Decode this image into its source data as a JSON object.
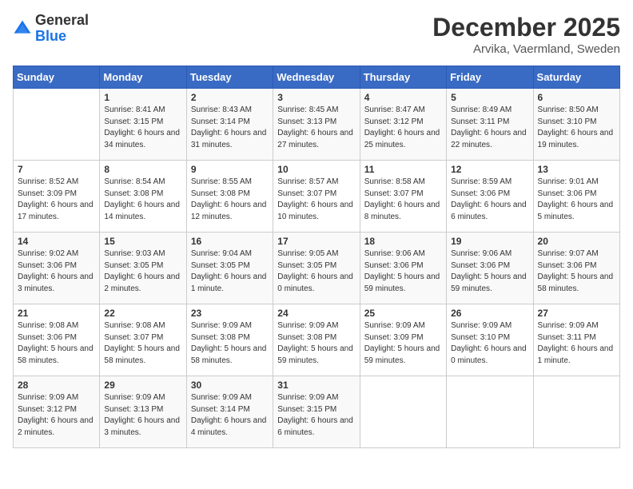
{
  "header": {
    "logo_line1": "General",
    "logo_line2": "Blue",
    "month": "December 2025",
    "location": "Arvika, Vaermland, Sweden"
  },
  "weekdays": [
    "Sunday",
    "Monday",
    "Tuesday",
    "Wednesday",
    "Thursday",
    "Friday",
    "Saturday"
  ],
  "weeks": [
    [
      {
        "day": "",
        "sunrise": "",
        "sunset": "",
        "daylight": ""
      },
      {
        "day": "1",
        "sunrise": "8:41 AM",
        "sunset": "3:15 PM",
        "daylight": "6 hours and 34 minutes."
      },
      {
        "day": "2",
        "sunrise": "8:43 AM",
        "sunset": "3:14 PM",
        "daylight": "6 hours and 31 minutes."
      },
      {
        "day": "3",
        "sunrise": "8:45 AM",
        "sunset": "3:13 PM",
        "daylight": "6 hours and 27 minutes."
      },
      {
        "day": "4",
        "sunrise": "8:47 AM",
        "sunset": "3:12 PM",
        "daylight": "6 hours and 25 minutes."
      },
      {
        "day": "5",
        "sunrise": "8:49 AM",
        "sunset": "3:11 PM",
        "daylight": "6 hours and 22 minutes."
      },
      {
        "day": "6",
        "sunrise": "8:50 AM",
        "sunset": "3:10 PM",
        "daylight": "6 hours and 19 minutes."
      }
    ],
    [
      {
        "day": "7",
        "sunrise": "8:52 AM",
        "sunset": "3:09 PM",
        "daylight": "6 hours and 17 minutes."
      },
      {
        "day": "8",
        "sunrise": "8:54 AM",
        "sunset": "3:08 PM",
        "daylight": "6 hours and 14 minutes."
      },
      {
        "day": "9",
        "sunrise": "8:55 AM",
        "sunset": "3:08 PM",
        "daylight": "6 hours and 12 minutes."
      },
      {
        "day": "10",
        "sunrise": "8:57 AM",
        "sunset": "3:07 PM",
        "daylight": "6 hours and 10 minutes."
      },
      {
        "day": "11",
        "sunrise": "8:58 AM",
        "sunset": "3:07 PM",
        "daylight": "6 hours and 8 minutes."
      },
      {
        "day": "12",
        "sunrise": "8:59 AM",
        "sunset": "3:06 PM",
        "daylight": "6 hours and 6 minutes."
      },
      {
        "day": "13",
        "sunrise": "9:01 AM",
        "sunset": "3:06 PM",
        "daylight": "6 hours and 5 minutes."
      }
    ],
    [
      {
        "day": "14",
        "sunrise": "9:02 AM",
        "sunset": "3:06 PM",
        "daylight": "6 hours and 3 minutes."
      },
      {
        "day": "15",
        "sunrise": "9:03 AM",
        "sunset": "3:05 PM",
        "daylight": "6 hours and 2 minutes."
      },
      {
        "day": "16",
        "sunrise": "9:04 AM",
        "sunset": "3:05 PM",
        "daylight": "6 hours and 1 minute."
      },
      {
        "day": "17",
        "sunrise": "9:05 AM",
        "sunset": "3:05 PM",
        "daylight": "6 hours and 0 minutes."
      },
      {
        "day": "18",
        "sunrise": "9:06 AM",
        "sunset": "3:06 PM",
        "daylight": "5 hours and 59 minutes."
      },
      {
        "day": "19",
        "sunrise": "9:06 AM",
        "sunset": "3:06 PM",
        "daylight": "5 hours and 59 minutes."
      },
      {
        "day": "20",
        "sunrise": "9:07 AM",
        "sunset": "3:06 PM",
        "daylight": "5 hours and 58 minutes."
      }
    ],
    [
      {
        "day": "21",
        "sunrise": "9:08 AM",
        "sunset": "3:06 PM",
        "daylight": "5 hours and 58 minutes."
      },
      {
        "day": "22",
        "sunrise": "9:08 AM",
        "sunset": "3:07 PM",
        "daylight": "5 hours and 58 minutes."
      },
      {
        "day": "23",
        "sunrise": "9:09 AM",
        "sunset": "3:08 PM",
        "daylight": "5 hours and 58 minutes."
      },
      {
        "day": "24",
        "sunrise": "9:09 AM",
        "sunset": "3:08 PM",
        "daylight": "5 hours and 59 minutes."
      },
      {
        "day": "25",
        "sunrise": "9:09 AM",
        "sunset": "3:09 PM",
        "daylight": "5 hours and 59 minutes."
      },
      {
        "day": "26",
        "sunrise": "9:09 AM",
        "sunset": "3:10 PM",
        "daylight": "6 hours and 0 minutes."
      },
      {
        "day": "27",
        "sunrise": "9:09 AM",
        "sunset": "3:11 PM",
        "daylight": "6 hours and 1 minute."
      }
    ],
    [
      {
        "day": "28",
        "sunrise": "9:09 AM",
        "sunset": "3:12 PM",
        "daylight": "6 hours and 2 minutes."
      },
      {
        "day": "29",
        "sunrise": "9:09 AM",
        "sunset": "3:13 PM",
        "daylight": "6 hours and 3 minutes."
      },
      {
        "day": "30",
        "sunrise": "9:09 AM",
        "sunset": "3:14 PM",
        "daylight": "6 hours and 4 minutes."
      },
      {
        "day": "31",
        "sunrise": "9:09 AM",
        "sunset": "3:15 PM",
        "daylight": "6 hours and 6 minutes."
      },
      {
        "day": "",
        "sunrise": "",
        "sunset": "",
        "daylight": ""
      },
      {
        "day": "",
        "sunrise": "",
        "sunset": "",
        "daylight": ""
      },
      {
        "day": "",
        "sunrise": "",
        "sunset": "",
        "daylight": ""
      }
    ]
  ]
}
